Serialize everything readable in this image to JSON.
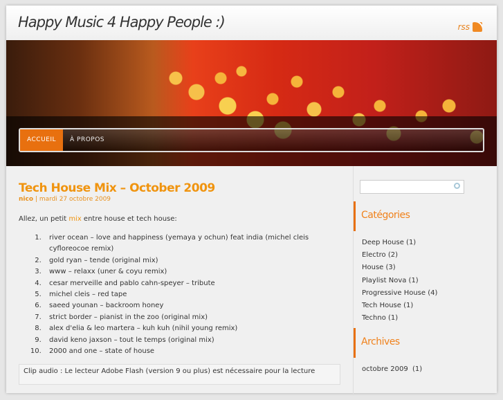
{
  "header": {
    "site_title": "Happy Music 4 Happy People :)",
    "rss_label": "rss"
  },
  "nav": {
    "items": [
      {
        "label": "ACCUEIL",
        "active": true
      },
      {
        "label": "À PROPOS",
        "active": false
      }
    ]
  },
  "post": {
    "title": "Tech House Mix – October 2009",
    "author": "nico",
    "separator": "|",
    "date": "mardi 27 octobre 2009",
    "intro_before": "Allez, un petit ",
    "intro_link": "mix",
    "intro_after": " entre house et tech house:",
    "tracks": [
      "river ocean – love and happiness (yemaya y ochun) feat india (michel cleis cyfloreocoe remix)",
      "gold ryan – tende (original mix)",
      "www – relaxx (uner & coyu remix)",
      "cesar merveille and pablo cahn-speyer – tribute",
      "michel cleis – red tape",
      "saeed younan – backroom honey",
      "strict border – pianist in the zoo (original mix)",
      "alex d'elia & leo martera – kuh kuh (nihil young remix)",
      "david keno jaxson – tout le temps (original mix)",
      "2000 and one – state of house"
    ],
    "flash_note": "Clip audio : Le lecteur Adobe Flash (version 9 ou plus) est nécessaire pour la lecture"
  },
  "sidebar": {
    "search_value": "",
    "categories_title": "Catégories",
    "categories": [
      "Deep House (1)",
      "Electro (2)",
      "House (3)",
      "Playlist Nova (1)",
      "Progressive House (4)",
      "Tech House (1)",
      "Techno (1)"
    ],
    "archives_title": "Archives",
    "archives": [
      "octobre 2009  (1)"
    ]
  },
  "colors": {
    "accent": "#e8700f",
    "title": "#f0940f"
  }
}
